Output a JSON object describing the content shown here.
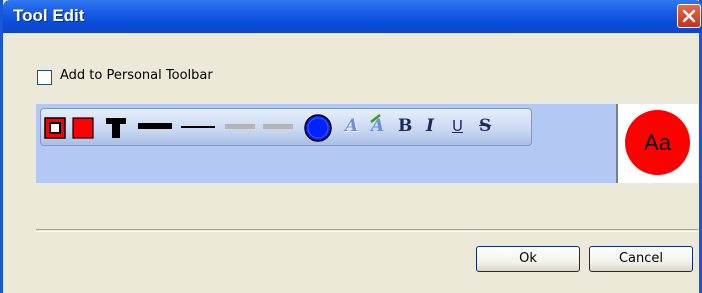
{
  "window": {
    "title": "Tool Edit",
    "close_icon": "close-icon"
  },
  "options": {
    "add_to_toolbar_label": "Add to Personal Toolbar",
    "add_to_toolbar_checked": false
  },
  "toolbar": {
    "items": [
      {
        "name": "outlined-square-icon",
        "color": "#ff0000"
      },
      {
        "name": "filled-square-icon",
        "color": "#ff0000"
      },
      {
        "name": "text-T-icon",
        "color": "#000000"
      },
      {
        "name": "thick-line-icon",
        "color": "#000000"
      },
      {
        "name": "thin-line-icon",
        "color": "#000000"
      },
      {
        "name": "gray-thick-line-icon",
        "color": "#b0b0b0"
      },
      {
        "name": "gray-thin-line-icon",
        "color": "#b0b0b0"
      },
      {
        "name": "blue-circle-icon",
        "color": "#0022ff"
      },
      {
        "name": "text-style-A-icon"
      },
      {
        "name": "text-style-A-alt-icon"
      },
      {
        "name": "bold-icon",
        "label": "B"
      },
      {
        "name": "italic-icon",
        "label": "I"
      },
      {
        "name": "underline-icon",
        "label": "U"
      },
      {
        "name": "strikethrough-icon",
        "label": "S"
      }
    ]
  },
  "preview": {
    "text": "Aa",
    "fill_color": "#ff0000"
  },
  "buttons": {
    "ok_label": "Ok",
    "cancel_label": "Cancel"
  }
}
